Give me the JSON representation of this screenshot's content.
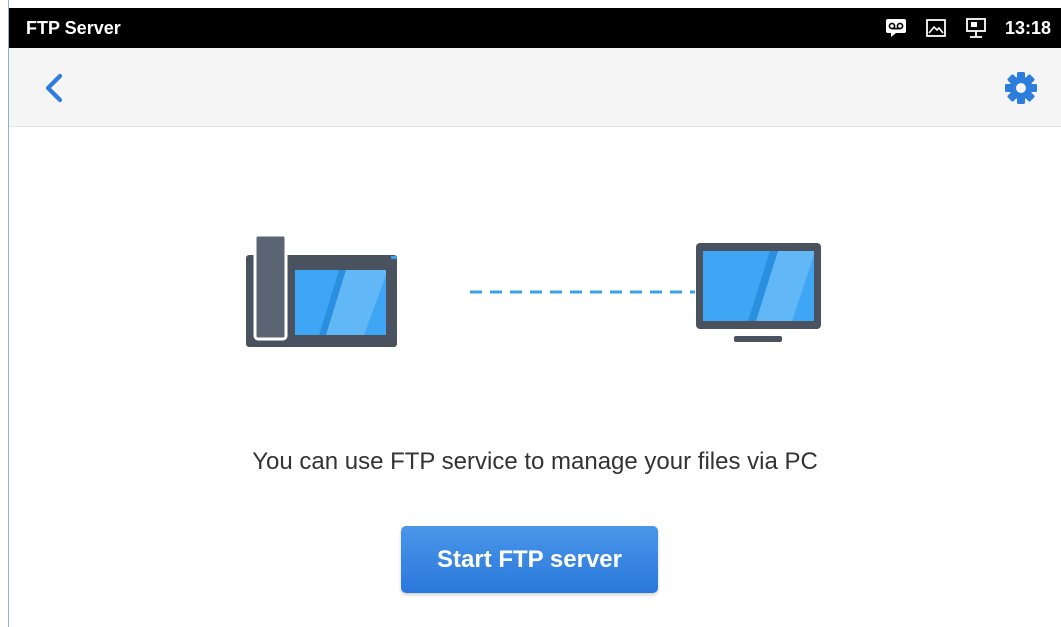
{
  "status_bar": {
    "title": "FTP Server",
    "time": "13:18",
    "icons": [
      "voicemail-icon",
      "image-icon",
      "network-icon"
    ]
  },
  "app_bar": {
    "back_icon": "chevron-left-icon",
    "settings_icon": "gear-icon"
  },
  "main": {
    "message": "You can use FTP service to manage your files via PC",
    "start_button_label": "Start FTP server"
  },
  "colors": {
    "accent": "#2d7ddd",
    "screen_blue": "#3ea6f5",
    "device_gray": "#4a5260",
    "link_line": "#3aa0e8"
  }
}
